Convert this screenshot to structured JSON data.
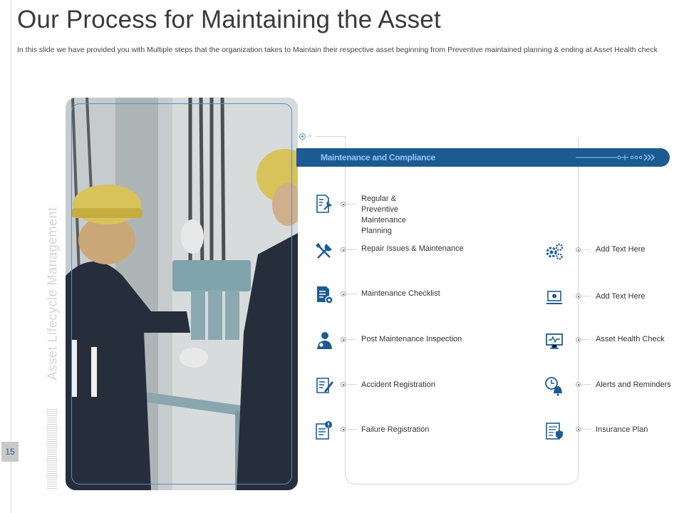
{
  "slide": {
    "title": "Our Process for Maintaining the Asset",
    "subtitle": "In this slide we have provided you with Multiple steps that the organization takes to Maintain their respective asset beginning from Preventive maintained planning & ending at Asset Health check",
    "page_number": "15",
    "vertical_label": "Asset Lifecycle Management"
  },
  "banner": {
    "label": "Maintenance and Compliance"
  },
  "left_items": [
    {
      "label": "Regular & Preventive\nMaintenance Planning",
      "icon": "wrench-document-icon"
    },
    {
      "label": "Repair Issues  & Maintenance",
      "icon": "tools-icon"
    },
    {
      "label": "Maintenance Checklist",
      "icon": "checklist-gear-icon"
    },
    {
      "label": "Post Maintenance Inspection",
      "icon": "inspector-person-icon"
    },
    {
      "label": "Accident Registration",
      "icon": "register-pen-icon"
    },
    {
      "label": "Failure Registration",
      "icon": "alert-document-icon"
    }
  ],
  "right_items": [
    {
      "label": "Add Text Here",
      "icon": "gears-icon"
    },
    {
      "label": "Add Text Here",
      "icon": "laptop-settings-icon"
    },
    {
      "label": "Asset Health Check",
      "icon": "monitor-pulse-icon"
    },
    {
      "label": "Alerts and Reminders",
      "icon": "clock-bell-icon"
    },
    {
      "label": "Insurance Plan",
      "icon": "policy-shield-icon"
    }
  ],
  "colors": {
    "accent": "#1c5b92",
    "banner_text": "#8ec6ff",
    "frame": "#5b8fc4"
  }
}
